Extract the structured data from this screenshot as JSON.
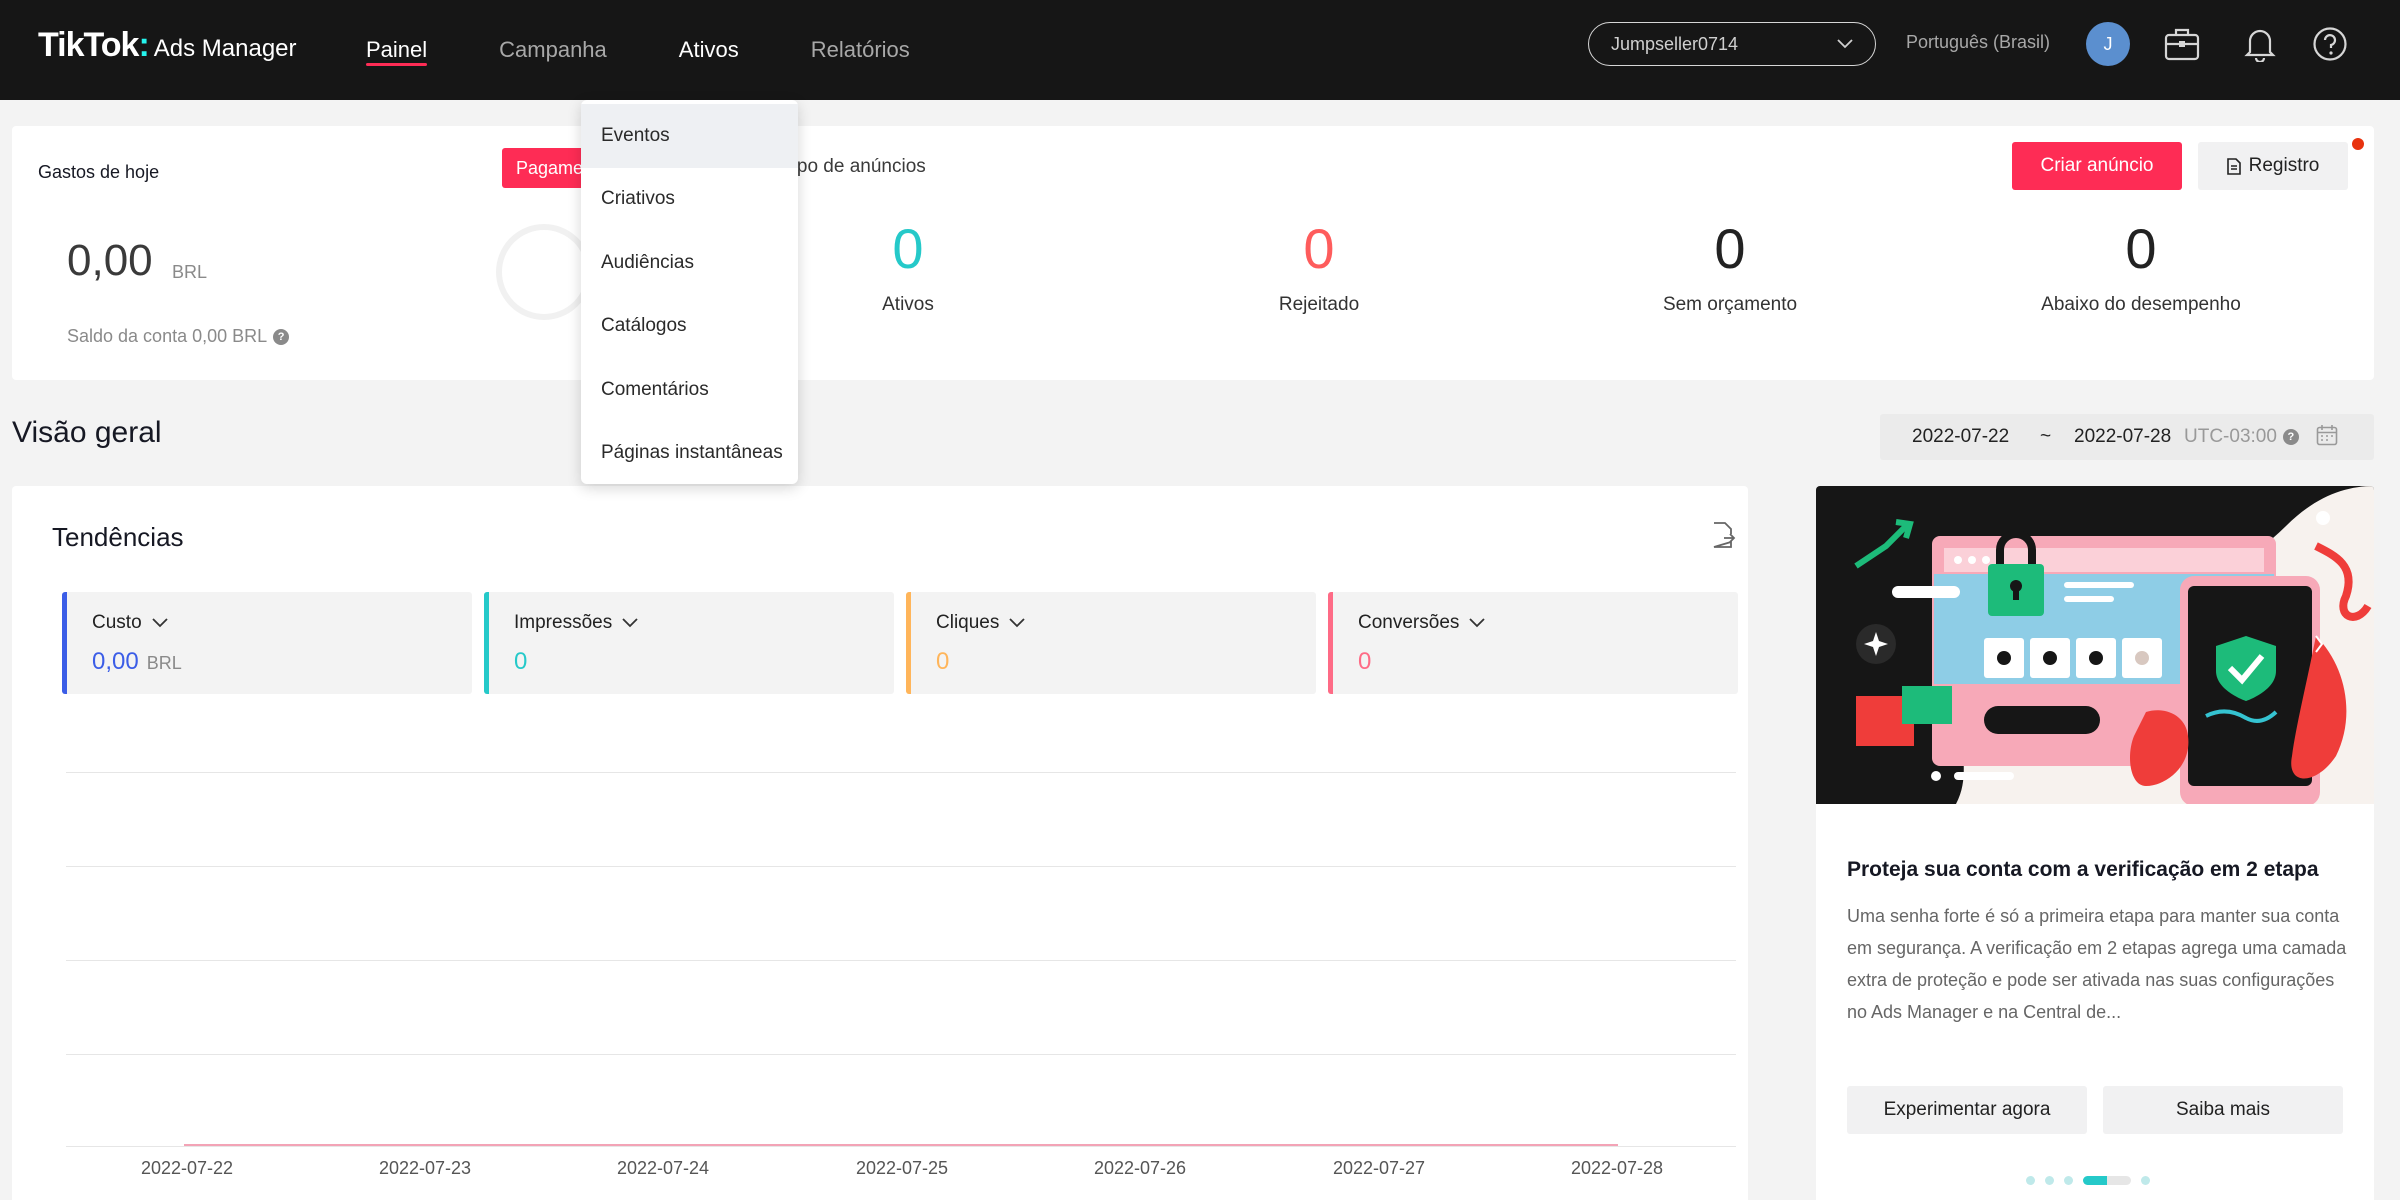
{
  "topbar": {
    "logo_brand": "TikTok",
    "logo_sub": "Ads Manager",
    "nav": [
      "Painel",
      "Campanha",
      "Ativos",
      "Relatórios"
    ],
    "account": "Jumpseller0714",
    "language": "Português (Brasil)",
    "avatar_initial": "J",
    "accent_color": "#fe2c55"
  },
  "dropdown": {
    "items": [
      "Eventos",
      "Criativos",
      "Audiências",
      "Catálogos",
      "Comentários",
      "Páginas instantâneas"
    ]
  },
  "summary": {
    "gastos_title": "Gastos de hoje",
    "gastos_value": "0,00",
    "gastos_unit": "BRL",
    "saldo": "Saldo da conta 0,00 BRL",
    "pill": "Pagame",
    "grupo_label": "rupo de anúncios",
    "stats": [
      {
        "value": "0",
        "label": "Ativos",
        "color": "#25c9c9"
      },
      {
        "value": "0",
        "label": "Rejeitado",
        "color": "#fe5c5c"
      },
      {
        "value": "0",
        "label": "Sem orçamento",
        "color": "#222222"
      },
      {
        "value": "0",
        "label": "Abaixo do desempenho",
        "color": "#222222"
      }
    ],
    "criar_button": "Criar anúncio",
    "registro_button": "Registro"
  },
  "overview": {
    "title": "Visão geral",
    "date_start": "2022-07-22",
    "tilde": "~",
    "date_end": "2022-07-28",
    "timezone": "UTC-03:00"
  },
  "trends": {
    "title": "Tendências",
    "metrics": [
      {
        "label": "Custo",
        "value": "0,00",
        "unit": "BRL",
        "color": "#3b5de7"
      },
      {
        "label": "Impressões",
        "value": "0",
        "unit": "",
        "color": "#25c9c9"
      },
      {
        "label": "Cliques",
        "value": "0",
        "unit": "",
        "color": "#ffb55a"
      },
      {
        "label": "Conversões",
        "value": "0",
        "unit": "",
        "color": "#fe6b86"
      }
    ],
    "x_labels": [
      "2022-07-22",
      "2022-07-23",
      "2022-07-24",
      "2022-07-25",
      "2022-07-26",
      "2022-07-27",
      "2022-07-28"
    ]
  },
  "promo": {
    "title": "Proteja sua conta com a verificação em 2 etapa",
    "body": "Uma senha forte é só a primeira etapa para manter sua conta em segurança. A verificação em 2 etapas agrega uma camada extra de proteção e pode ser ativada nas suas configurações no Ads Manager e na Central de...",
    "btn_try": "Experimentar agora",
    "btn_more": "Saiba mais"
  }
}
